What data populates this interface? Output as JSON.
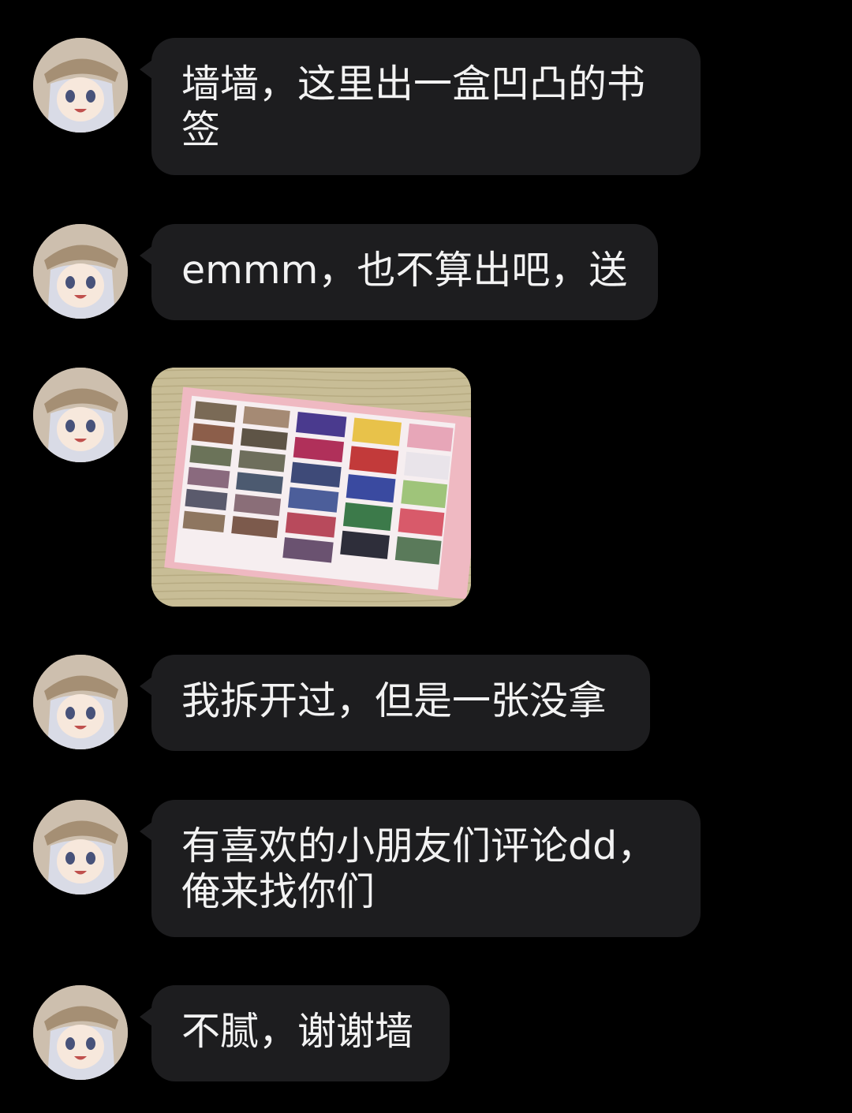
{
  "theme": {
    "background": "#000000",
    "bubble": "#1d1d1f",
    "text": "#f2f2f2"
  },
  "sender": {
    "avatar_icon": "anime-girl-avatar-icon"
  },
  "messages": [
    {
      "type": "text",
      "text": "墙墙，这里出一盒凹凸的书签"
    },
    {
      "type": "text",
      "text": "emmm，也不算出吧，送"
    },
    {
      "type": "image",
      "image": "photo of anime bookmark sheet"
    },
    {
      "type": "text",
      "text": "我拆开过，但是一张没拿"
    },
    {
      "type": "text",
      "text": "有喜欢的小朋友们评论dd，俺来找你们"
    },
    {
      "type": "text",
      "text": "不腻，谢谢墙"
    }
  ]
}
